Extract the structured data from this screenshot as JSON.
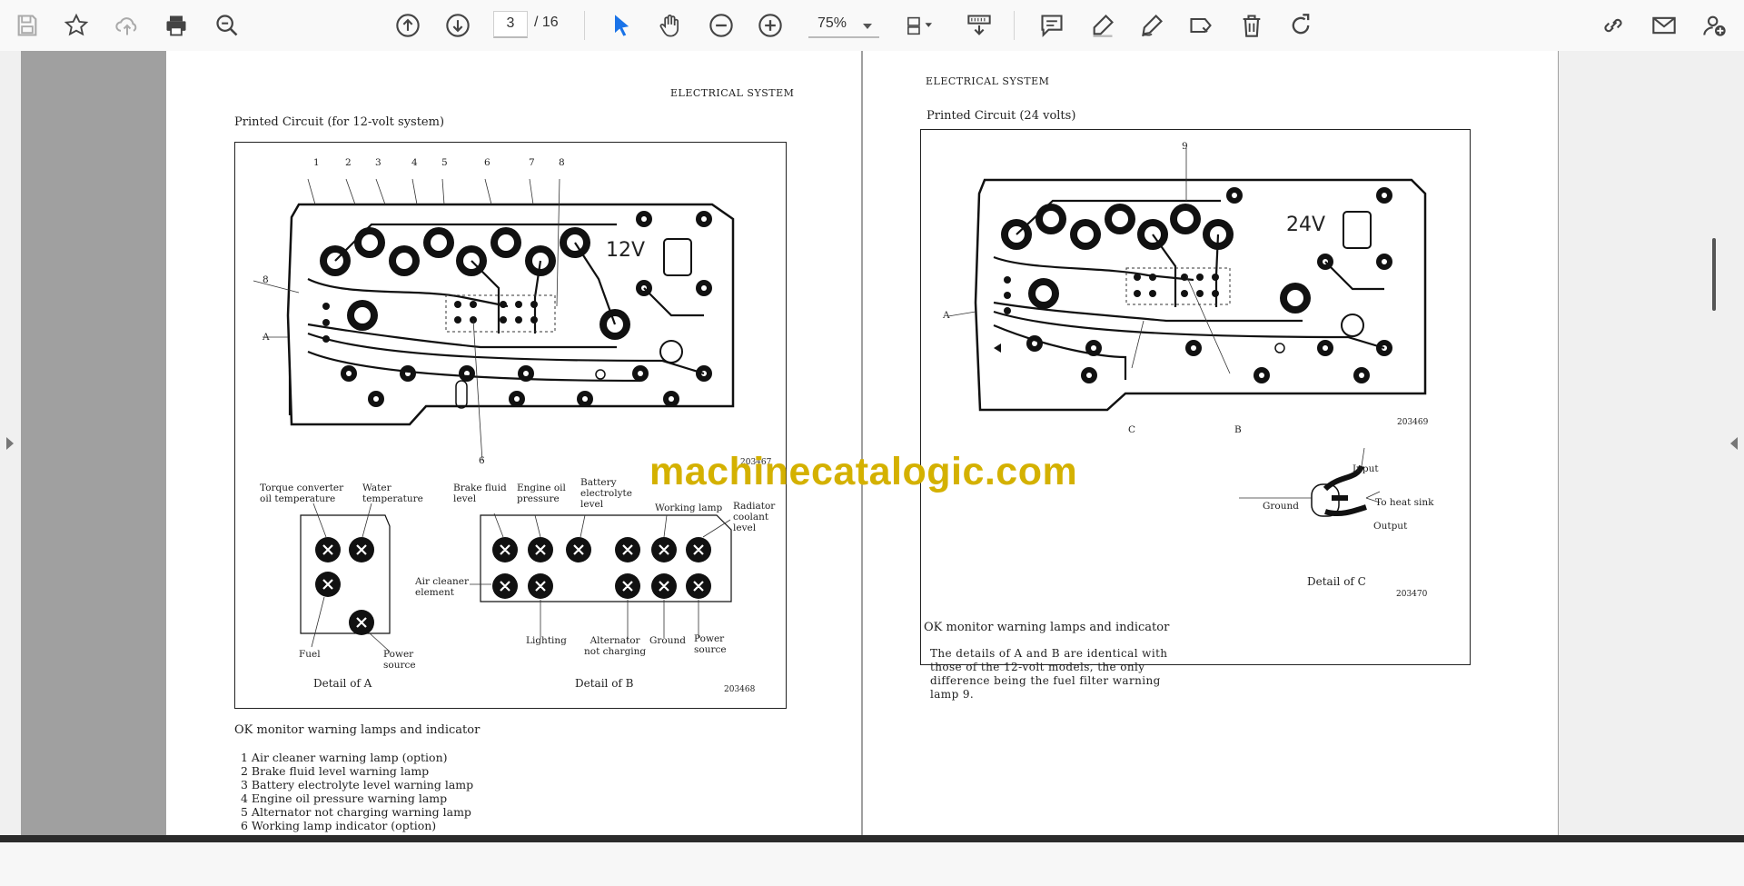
{
  "toolbar": {
    "left_icons": [
      "save-icon",
      "bookmark-star-icon",
      "cloud-upload-icon",
      "print-icon",
      "zoom-search-icon"
    ],
    "page_current": "3",
    "page_total": "/ 16",
    "zoom_value": "75%",
    "right_icons": [
      "comment-icon",
      "highlight-pen-icon",
      "draw-icon",
      "stamp-icon",
      "delete-icon",
      "redo-icon"
    ],
    "far_right_icons": [
      "share-link-icon",
      "email-icon",
      "add-user-icon"
    ]
  },
  "colors": {
    "accent": "#1a73e8",
    "watermark": "#d4b100",
    "viewer_bg": "#a0a0a0"
  },
  "watermark": "machinecatalogic.com",
  "left_page": {
    "header": "ELECTRICAL SYSTEM",
    "figure_title": "Printed Circuit (for 12-volt system)",
    "board_voltage": "12V",
    "top_numbers": [
      "1",
      "2",
      "3",
      "4",
      "5",
      "6",
      "7",
      "8"
    ],
    "side_labels": [
      "8",
      "A"
    ],
    "bottom_number": "6",
    "fig1_code": "203467",
    "detail_a_labels": {
      "torque": "Torque converter\noil temperature",
      "water": "Water\ntemperature",
      "fuel": "Fuel",
      "power": "Power\nsource",
      "caption": "Detail of A"
    },
    "detail_b_labels": {
      "brake": "Brake fluid\nlevel",
      "engine": "Engine oil\npressure",
      "battery": "Battery\nelectrolyte\nlevel",
      "working": "Working lamp",
      "radiator": "Radiator\ncoolant\nlevel",
      "aircleaner": "Air cleaner\nelement",
      "lighting": "Lighting",
      "alternator": "Alternator\nnot charging",
      "ground": "Ground",
      "power": "Power\nsource",
      "caption": "Detail of B"
    },
    "fig2_code": "203468",
    "section_title": "OK monitor warning lamps and indicator",
    "list": [
      "1  Air cleaner warning lamp (option)",
      "2  Brake fluid level warning lamp",
      "3  Battery electrolyte level warning lamp",
      "4  Engine oil pressure warning lamp",
      "5  Alternator not charging warning lamp",
      "6  Working lamp indicator (option)"
    ]
  },
  "right_page": {
    "header": "ELECTRICAL SYSTEM",
    "figure_title": "Printed Circuit (24 volts)",
    "board_voltage": "24V",
    "top_number": "9",
    "side_label": "A",
    "bottom_labels": [
      "C",
      "B"
    ],
    "fig1_code": "203469",
    "detail_c_labels": {
      "input": "Input",
      "ground": "Ground",
      "heat": "To heat sink",
      "output": "Output",
      "caption": "Detail of C"
    },
    "fig2_code": "203470",
    "section_title": "OK monitor warning lamps and indicator",
    "paragraph": [
      "The details of A and B are identical with",
      "those of the 12-volt models, the only",
      "difference being the fuel filter warning",
      "lamp 9."
    ]
  }
}
